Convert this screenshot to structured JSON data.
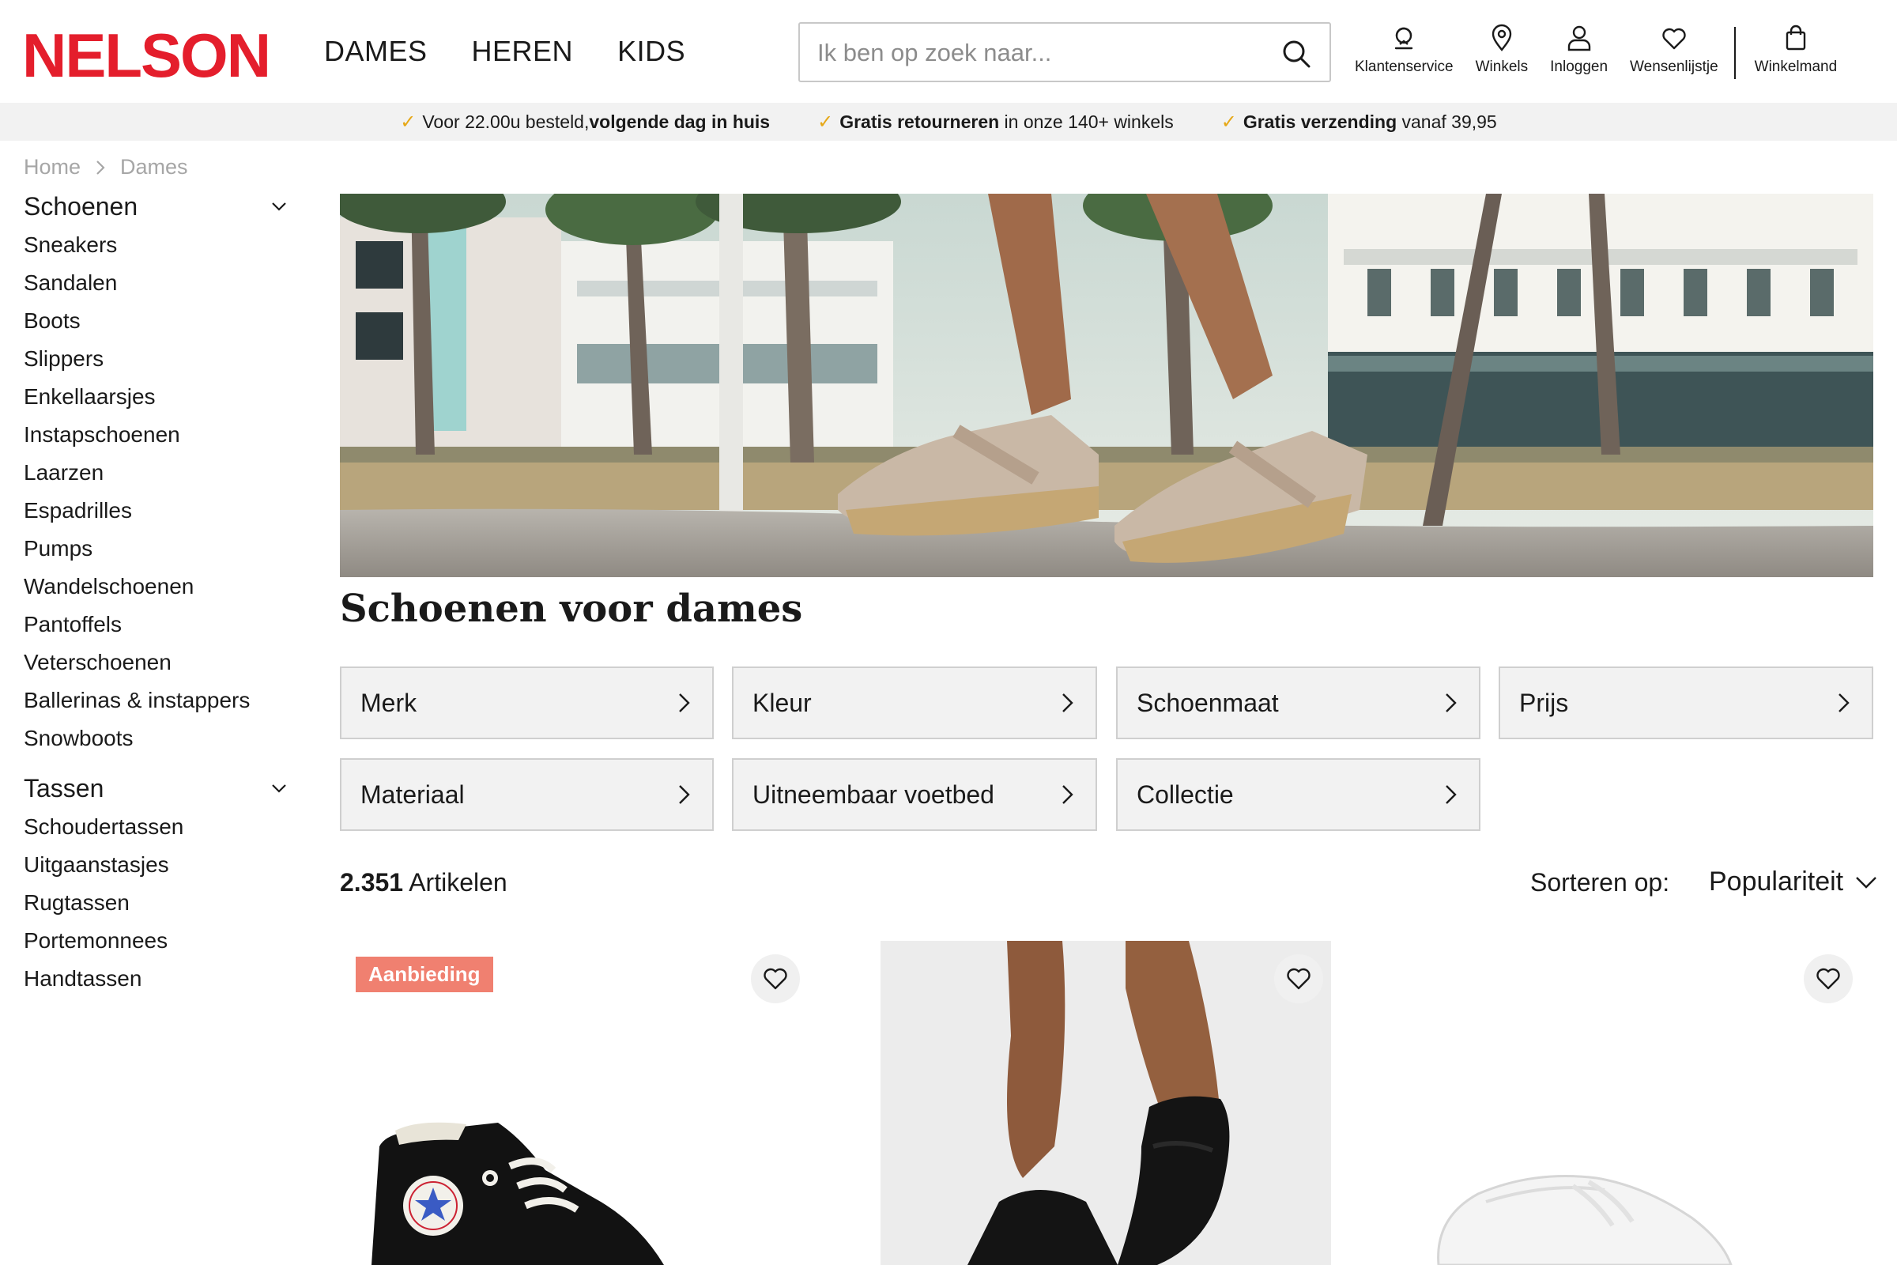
{
  "brand": {
    "logo_text": "NELSON",
    "accent": "#e41e2c"
  },
  "main_nav": [
    "DAMES",
    "HEREN",
    "KIDS"
  ],
  "search": {
    "placeholder": "Ik ben op zoek naar...",
    "value": ""
  },
  "user_nav": [
    {
      "label": "Klantenservice",
      "icon": "headset-icon"
    },
    {
      "label": "Winkels",
      "icon": "location-pin-icon"
    },
    {
      "label": "Inloggen",
      "icon": "user-icon"
    },
    {
      "label": "Wensenlijstje",
      "icon": "heart-icon"
    },
    {
      "label": "Winkelmand",
      "icon": "shopping-bag-icon"
    }
  ],
  "usp": [
    {
      "pre": "Voor 22.00u besteld, ",
      "bold": "volgende dag in huis",
      "post": ""
    },
    {
      "pre": "",
      "bold": "Gratis retourneren",
      "post": " in onze 140+ winkels"
    },
    {
      "pre": "",
      "bold": "Gratis verzending",
      "post": " vanaf 39,95"
    }
  ],
  "breadcrumb": [
    "Home",
    "Dames"
  ],
  "sidebar": {
    "shoes_title": "Schoenen",
    "shoes": [
      "Sneakers",
      "Sandalen",
      "Boots",
      "Slippers",
      "Enkellaarsjes",
      "Instapschoenen",
      "Laarzen",
      "Espadrilles",
      "Pumps",
      "Wandelschoenen",
      "Pantoffels",
      "Veterschoenen",
      "Ballerinas & instappers",
      "Snowboots"
    ],
    "bags_title": "Tassen",
    "bags": [
      "Schoudertassen",
      "Uitgaanstasjes",
      "Rugtassen",
      "Portemonnees",
      "Handtassen"
    ]
  },
  "page_title": "Schoenen voor dames",
  "filters": [
    "Merk",
    "Kleur",
    "Schoenmaat",
    "Prijs",
    "Materiaal",
    "Uitneembaar voetbed",
    "Collectie"
  ],
  "results": {
    "count": "2.351",
    "label": " Artikelen"
  },
  "sort": {
    "label": "Sorteren op:",
    "value": "Populariteit"
  },
  "products": [
    {
      "badge": "Aanbieding",
      "kind": "black high-top sneaker"
    },
    {
      "badge": "",
      "kind": "black sandal"
    },
    {
      "badge": "",
      "kind": "white sneaker"
    }
  ],
  "colors": {
    "badge": "#f08070",
    "check": "#e6a817",
    "usp_bg": "#f2f2f2",
    "filter_bg": "#f2f2f2"
  }
}
